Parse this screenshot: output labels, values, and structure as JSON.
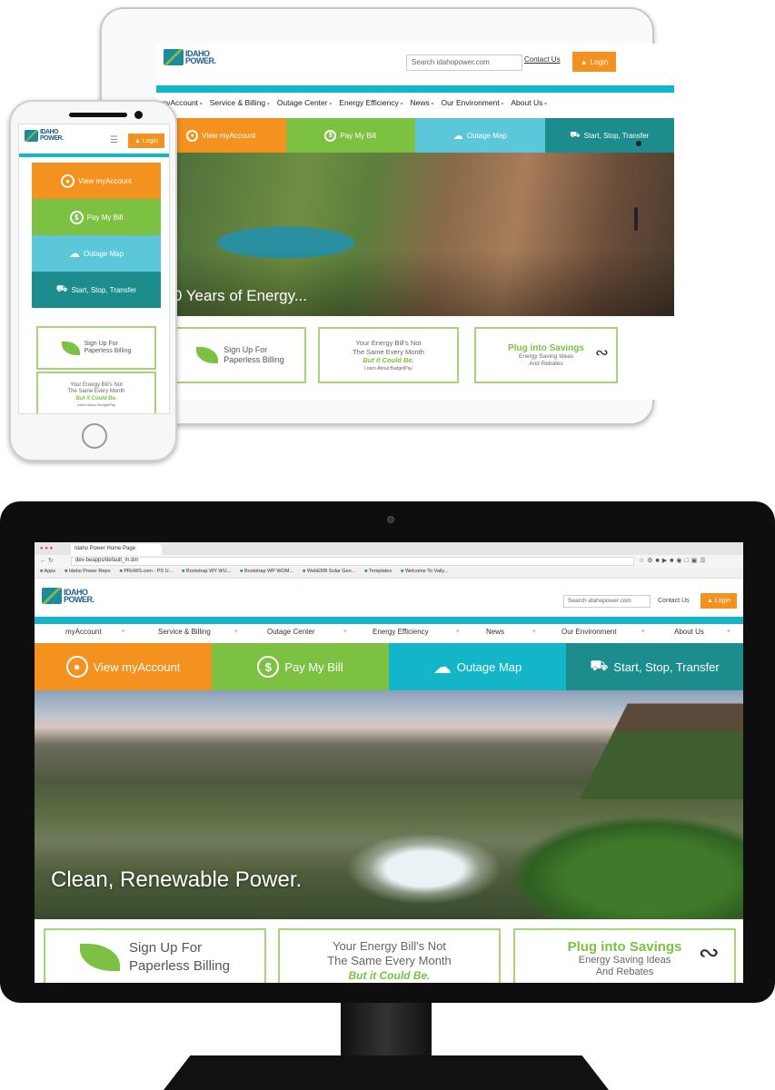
{
  "colors": {
    "orange": "#f3921f",
    "green": "#7cc142",
    "teal_light": "#5bc7d8",
    "teal_dark": "#1c8c8c",
    "accent_teal": "#13b5c9",
    "card_border": "#a7d47a"
  },
  "brand": {
    "logo_line1": "IDAHO",
    "logo_line2": "POWER."
  },
  "header": {
    "search_placeholder": "Search idahopower.com",
    "contact": "Contact Us",
    "login": "Login"
  },
  "nav": [
    "myAccount",
    "Service & Billing",
    "Outage Center",
    "Energy Efficiency",
    "News",
    "Our Environment",
    "About Us"
  ],
  "actions": {
    "account": "View myAccount",
    "pay": "Pay My Bill",
    "outage": "Outage Map",
    "transfer": "Start, Stop, Transfer"
  },
  "cards": {
    "paperless_line1": "Sign Up For",
    "paperless_line2": "Paperless Billing",
    "bill_line1": "Your Energy Bill's Not",
    "bill_line2": "The Same Every Month",
    "bill_line3": "But it Could Be.",
    "bill_link": "Learn About BudgetPay",
    "savings_title": "Plug into Savings",
    "savings_line1": "Energy Saving Ideas",
    "savings_line2": "And Rebates"
  },
  "tablet": {
    "hero_text": "100 Years of Energy..."
  },
  "monitor": {
    "hero_text": "Clean, Renewable Power.",
    "browser_tab": "Idaho Power Home Page",
    "url": "dev-beapps/default_m.dm",
    "bookmarks": [
      "Apps",
      "Idaho Power Repo",
      "PRoWS.com - PS U...",
      "Bootstrap WY WU...",
      "Bootstrap WP WOM...",
      "WebERB Solar Gen...",
      "Templates",
      "Welcome To Vaily..."
    ]
  }
}
